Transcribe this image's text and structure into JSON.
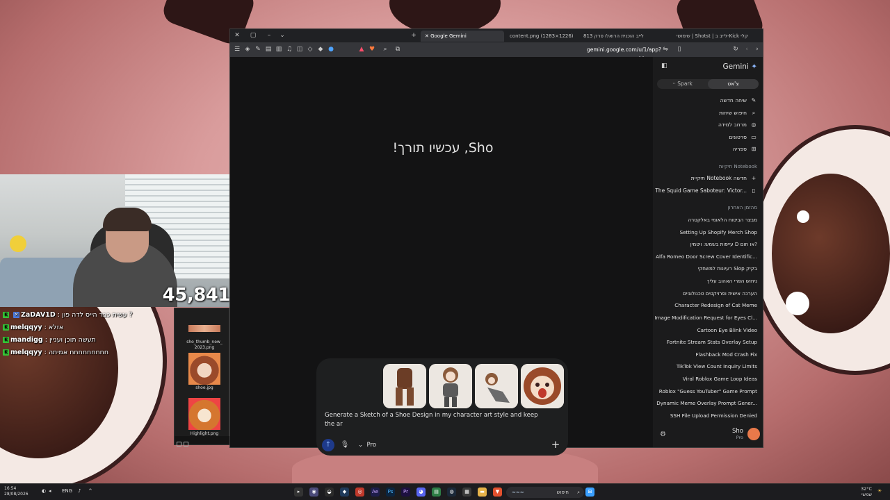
{
  "colors": {
    "gemini_blue": "#8ab4f8",
    "sidebar_bg": "#1b1b1c",
    "main_bg": "#131314",
    "composer_bg": "#1e1f20",
    "chat_badge": "#37c837"
  },
  "stream": {
    "counter": "45,841",
    "chat": [
      {
        "user": "ZaDAV1D",
        "message": ": עשית כבר הייס לדה פון ?"
      },
      {
        "user": "melqqyy",
        "message": ": אזלא"
      },
      {
        "user": "mandigg",
        "message": ": תעשה תוכן ועניין"
      },
      {
        "user": "melqqyy",
        "message": ": חחחחחחחחח אמיתה"
      }
    ]
  },
  "explorer": {
    "files": [
      {
        "name": "sho_thumb_new_ 2023.png"
      },
      {
        "name": "shoe.jpg"
      },
      {
        "name": "Highlight.png"
      }
    ]
  },
  "browser": {
    "tabs": [
      {
        "label": "Google Gemini",
        "active": true
      },
      {
        "label": "content.png (1283×1226)"
      },
      {
        "label": "לייב הוכנית הרואלו פרק 813"
      },
      {
        "label": "שימושי | Shotst | לייב ב-Kick קלי"
      }
    ],
    "url": "gemini.google.com/u/1/app?pageId=none"
  },
  "gemini": {
    "greeting": "Sho, עכשיו תורך!",
    "prompt": "Generate a Sketch of a Shoe Design in my character art style and keep the ar",
    "model": "Pro",
    "brand": "Gemini",
    "tabs": {
      "spark": "Spark",
      "chat": "צ'אט"
    },
    "nav": [
      {
        "label": "שיחה חדשה",
        "icon": "edit-icon"
      },
      {
        "label": "חיפוש שיחות",
        "icon": "search-icon"
      },
      {
        "label": "מרחב למידה",
        "icon": "learning-icon"
      },
      {
        "label": "סרטונים",
        "icon": "video-icon"
      },
      {
        "label": "ספריה",
        "icon": "library-icon"
      }
    ],
    "notebook_section": "תיקיות Notebook",
    "notebook_items": [
      {
        "label": "תיקיית Notebook חדשה",
        "icon": "plus-icon"
      },
      {
        "label": "The Squid Game Saboteur: Victor...",
        "icon": "notebook-icon"
      }
    ],
    "recent_section": "מהזמן האחרון",
    "recent": [
      "מבצר הביטוח הלאומי באלקטרה",
      "Setting Up Shopify Merch Shop",
      "עייפות בשמש: ויטמין D או חום?",
      "Alfa Romeo Door Screw Cover Identific...",
      "רעיונות למשחקי Slop בקיק",
      "ניחוש הפרי האהוב עליך",
      "הערכה אישית ופרויקטים טכנולוגיים",
      "Character Redesign of Cat Meme",
      "Image Modification Request for Eyes Cl...",
      "Cartoon Eye Blink Video",
      "Fortnite Stream Stats Overlay Setup",
      "Flashback Mod Crash Fix",
      "TikTok View Count Inquiry Limits",
      "Viral Roblox Game Loop Ideas",
      "Roblox \"Guess YouTuber\" Game Prompt",
      "Dynamic Meme Overlay Prompt Gener...",
      "SSH File Upload Permission Denied"
    ],
    "user": {
      "name": "Sho",
      "plan": "Pro"
    }
  },
  "taskbar": {
    "time": "16:54",
    "date": "28/08/2026",
    "lang": "ENG",
    "search_placeholder": "חיפוש",
    "weather_temp": "32°C",
    "weather_desc": "שמשי"
  }
}
